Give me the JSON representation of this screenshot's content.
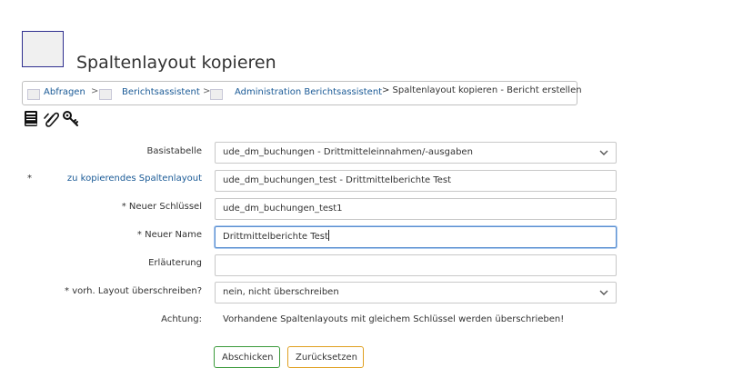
{
  "header": {
    "title": "Spaltenlayout kopieren"
  },
  "breadcrumb": {
    "items": [
      {
        "label": "Abfragen"
      },
      {
        "label": "Berichtsassistent"
      },
      {
        "label": "Administration Berichtsassistent"
      }
    ],
    "separator": ">",
    "current": "> Spaltenlayout kopieren - Bericht erstellen"
  },
  "toolbar": {
    "icons": [
      "book-icon",
      "paperclip-icon",
      "keys-icon"
    ]
  },
  "form": {
    "basistabelle": {
      "label": "Basistabelle",
      "value": "ude_dm_buchungen - Drittmitteleinnahmen/-ausgaben"
    },
    "spaltenlayout": {
      "star": "*",
      "label": "zu kopierendes Spaltenlayout",
      "value": "ude_dm_buchungen_test - Drittmittelberichte Test"
    },
    "neuer_schluessel": {
      "label": "* Neuer Schlüssel",
      "value": "ude_dm_buchungen_test1"
    },
    "neuer_name": {
      "label": "* Neuer Name",
      "value": "Drittmittelberichte Test"
    },
    "erlaeuterung": {
      "label": "Erläuterung",
      "value": ""
    },
    "ueberschreiben": {
      "label": "* vorh. Layout überschreiben?",
      "value": "nein, nicht überschreiben"
    },
    "achtung": {
      "label": "Achtung:",
      "text": "Vorhandene Spaltenlayouts mit gleichem Schlüssel werden überschrieben!"
    }
  },
  "buttons": {
    "submit_label": "Abschicken",
    "reset_label": "Zurücksetzen"
  },
  "colors": {
    "link": "#1a5a96",
    "submit_border": "#3a9a3a",
    "reset_border": "#e0a020",
    "focus_border": "#5b8fd0"
  }
}
